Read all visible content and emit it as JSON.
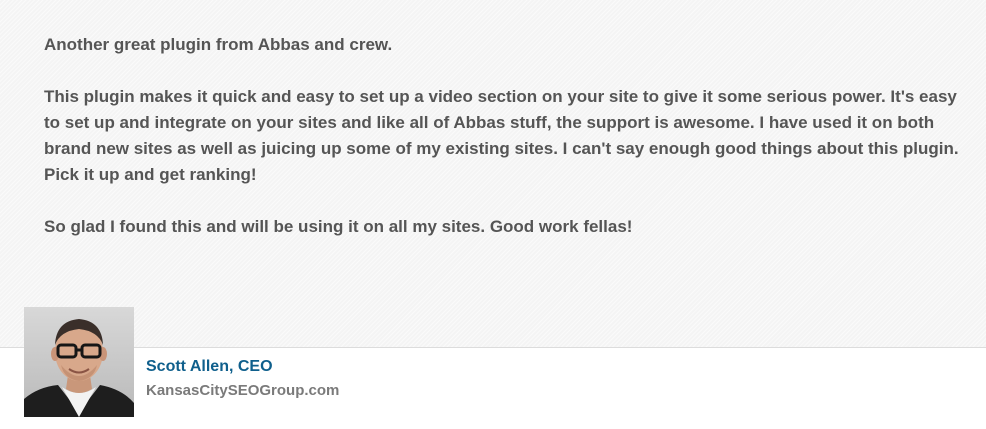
{
  "testimonial": {
    "paragraphs": [
      "Another great plugin from Abbas and crew.",
      "This plugin makes it quick and easy to set up a video section on your site to give it some serious power. It's easy to set up and integrate on your sites and like all of Abbas stuff, the support is awesome. I have used it on both brand new sites as well as juicing up some of my existing sites. I can't say enough good things about this plugin. Pick it up and get ranking!",
      "So glad I found this and will be using it on all my sites. Good work fellas!"
    ],
    "author": {
      "name": "Scott Allen, CEO",
      "site": "KansasCitySEOGroup.com",
      "avatar_icon": "person-photo-avatar"
    }
  },
  "colors": {
    "quote_background": "#f4f4f4",
    "quote_text": "#555555",
    "author_name": "#0f5f8c",
    "author_site": "#7a7a7a"
  }
}
